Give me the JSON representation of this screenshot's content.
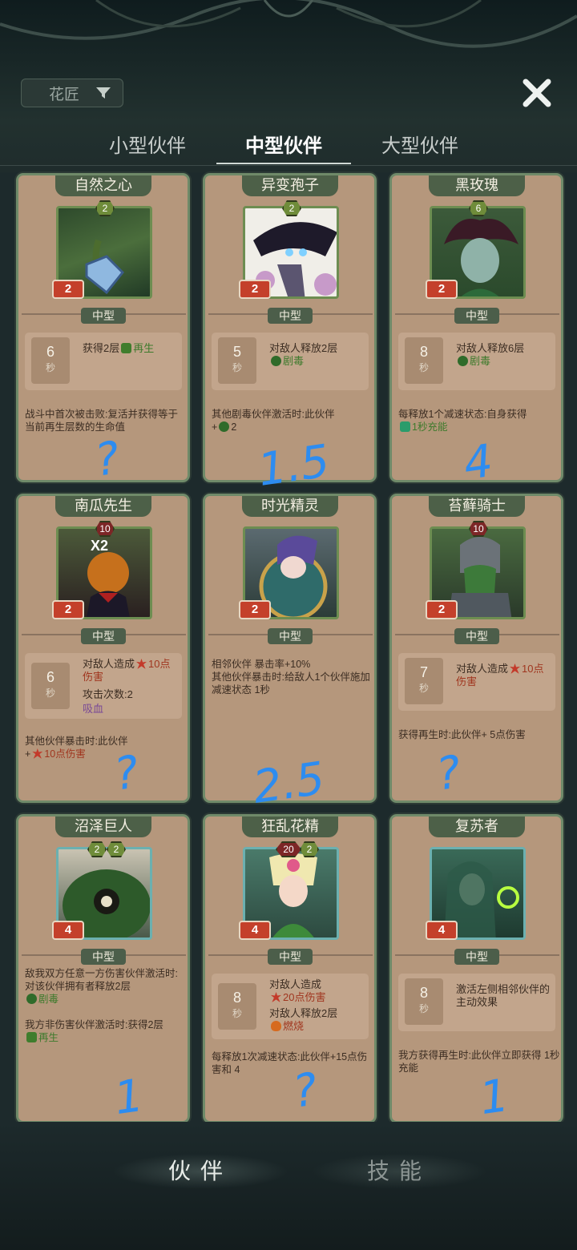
{
  "header": {
    "filter": {
      "label": "花匠",
      "icon": "funnel-icon"
    },
    "close_icon": "close-icon"
  },
  "tabs": [
    {
      "label": "小型伙伴",
      "active": false
    },
    {
      "label": "中型伙伴",
      "active": true
    },
    {
      "label": "大型伙伴",
      "active": false
    }
  ],
  "cards": [
    {
      "name": "自然之心",
      "costs": [
        "2"
      ],
      "damage": "2",
      "size": "中型",
      "cooldown": "6",
      "cooldown_unit": "秒",
      "effect1": "获得2层",
      "effect1_tag": "再生",
      "desc": "战斗中首次被击败:复活并获得等于当前再生层数的生命值",
      "note": "?"
    },
    {
      "name": "异变孢子",
      "costs": [
        "2"
      ],
      "damage": "2",
      "size": "中型",
      "cooldown": "5",
      "cooldown_unit": "秒",
      "effect1": "对敌人释放2层",
      "effect1_tag": "剧毒",
      "desc": "其他剧毒伙伴激活时:此伙伴",
      "desc2": "2",
      "note": "1.5"
    },
    {
      "name": "黑玫瑰",
      "costs": [
        "6"
      ],
      "damage": "2",
      "size": "中型",
      "cooldown": "8",
      "cooldown_unit": "秒",
      "effect1": "对敌人释放6层",
      "effect1_tag": "剧毒",
      "desc": "每释放1个减速状态:自身获得",
      "desc2": "1秒充能",
      "note": "4"
    },
    {
      "name": "南瓜先生",
      "costs": [
        "10"
      ],
      "damage": "2",
      "size": "中型",
      "multiplier": "X2",
      "cooldown": "6",
      "cooldown_unit": "秒",
      "effect1": "对敌人造成",
      "effect1_tag": "10点伤害",
      "effect2": "攻击次数:2",
      "effect3": "吸血",
      "desc": "其他伙伴暴击时:此伙伴",
      "desc2": "10点伤害",
      "note": "?"
    },
    {
      "name": "时光精灵",
      "costs": [],
      "damage": "2",
      "size": "中型",
      "desc": "相邻伙伴 暴击率+10%",
      "desc2": "其他伙伴暴击时:给敌人1个伙伴施加减速状态 1秒",
      "note": "2.5"
    },
    {
      "name": "苔藓骑士",
      "costs": [
        "10"
      ],
      "damage": "2",
      "size": "中型",
      "cooldown": "7",
      "cooldown_unit": "秒",
      "effect1": "对敌人造成",
      "effect1_tag": "10点伤害",
      "desc": "获得再生时:此伙伴+ 5点伤害",
      "note": "?"
    },
    {
      "name": "沼泽巨人",
      "costs": [
        "2",
        "2"
      ],
      "damage": "4",
      "size": "中型",
      "desc": "敌我双方任意一方伤害伙伴激活时:对该伙伴拥有者释放2层",
      "desc_tag": "剧毒",
      "desc2": "我方非伤害伙伴激活时:获得2层",
      "desc2_tag": "再生",
      "note": "1"
    },
    {
      "name": "狂乱花精",
      "costs": [
        "20",
        "2"
      ],
      "damage": "4",
      "size": "中型",
      "cooldown": "8",
      "cooldown_unit": "秒",
      "effect1": "对敌人造成",
      "effect1_tag": "20点伤害",
      "effect2": "对敌人释放2层",
      "effect2_tag": "燃烧",
      "desc": "每释放1次减速状态:此伙伴+15点伤害和 4",
      "note": "?"
    },
    {
      "name": "复苏者",
      "costs": [],
      "damage": "4",
      "size": "中型",
      "cooldown": "8",
      "cooldown_unit": "秒",
      "effect1": "激活左侧相邻伙伴的主动效果",
      "desc": "我方获得再生时:此伙伴立即获得 1秒充能",
      "note": "1"
    }
  ],
  "bottom_tabs": [
    {
      "label": "伙伴",
      "active": true
    },
    {
      "label": "技能",
      "active": false
    }
  ]
}
